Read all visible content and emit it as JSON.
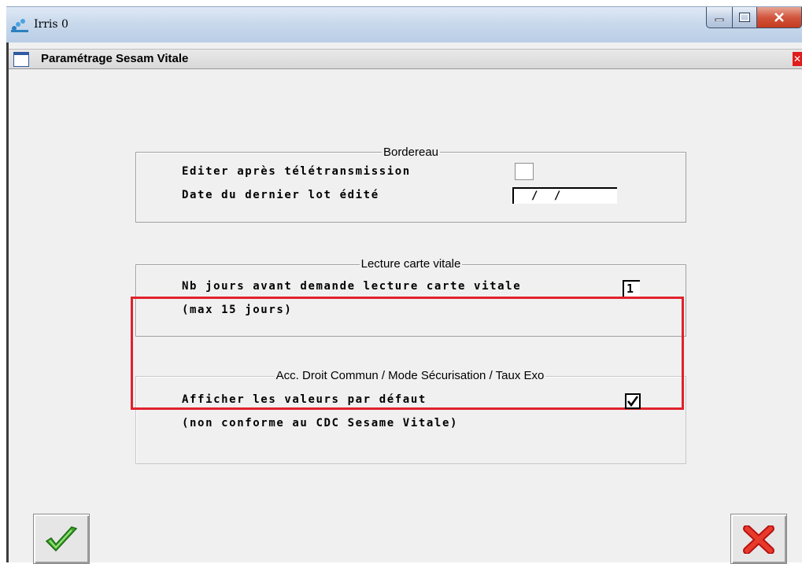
{
  "window": {
    "title": "Irris 0",
    "icon": "app-icon",
    "buttons": [
      "minimize-icon",
      "maximize-icon",
      "close-icon"
    ]
  },
  "child_window": {
    "title": "Paramétrage Sesam Vitale",
    "close_label": "✕"
  },
  "bordereau": {
    "title": "Bordereau",
    "editer_label": "Editer après télétransmission",
    "editer_checked": false,
    "date_label": "Date du dernier lot édité",
    "date_value": "/ /"
  },
  "lecture": {
    "title": "Lecture carte vitale",
    "nb_jours_label": "Nb jours avant demande lecture carte vitale",
    "nb_jours_value": "1",
    "max_note": "(max 15 jours)"
  },
  "acc": {
    "title": "Acc. Droit Commun / Mode Sécurisation / Taux Exo",
    "afficher_label": "Afficher les valeurs par défaut",
    "afficher_checked": true,
    "note": "(non conforme au CDC Sesame Vitale)"
  },
  "actions": {
    "ok_icon": "checkmark-icon",
    "cancel_icon": "red-x-icon"
  },
  "colors": {
    "highlight_border": "#e0222c",
    "ok_green": "#3aa82a",
    "cancel_red": "#e01c1c"
  }
}
